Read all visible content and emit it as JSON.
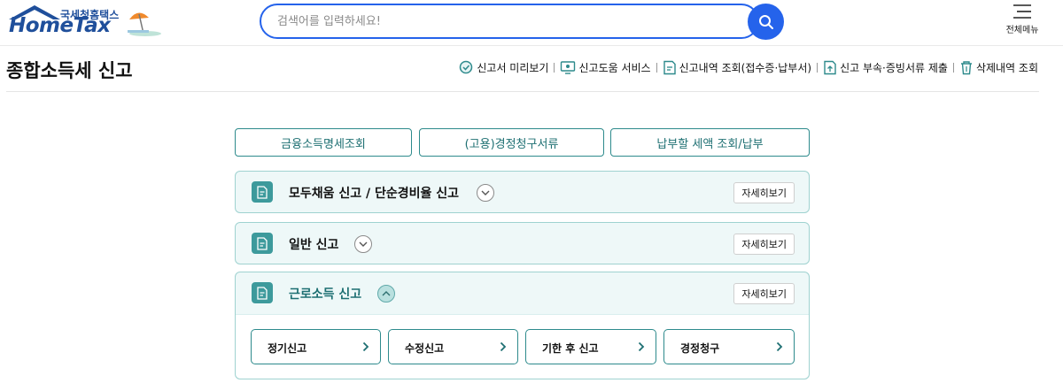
{
  "header": {
    "logo_sub": "국세청홈택스",
    "logo_main": "HomeTax",
    "search_placeholder": "검색어를 입력하세요!",
    "menu_label": "전체메뉴"
  },
  "page": {
    "title": "종합소득세 신고"
  },
  "quick_links": [
    {
      "label": "신고서 미리보기",
      "icon": "magnify-doc-icon"
    },
    {
      "label": "신고도움 서비스",
      "icon": "monitor-help-icon"
    },
    {
      "label": "신고내역 조회(접수증·납부서)",
      "icon": "doc-list-icon"
    },
    {
      "label": "신고 부속·증빙서류 제출",
      "icon": "doc-upload-icon"
    },
    {
      "label": "삭제내역 조회",
      "icon": "trash-icon"
    }
  ],
  "top_buttons": [
    {
      "label": "금융소득명세조회"
    },
    {
      "label": "(고용)경정청구서류"
    },
    {
      "label": "납부할 세액 조회/납부"
    }
  ],
  "cards": [
    {
      "title": "모두채움 신고 / 단순경비율 신고",
      "detail_label": "자세히보기",
      "state": "collapsed"
    },
    {
      "title": "일반 신고",
      "detail_label": "자세히보기",
      "state": "collapsed"
    },
    {
      "title": "근로소득 신고",
      "detail_label": "자세히보기",
      "state": "expanded",
      "sub_buttons": [
        {
          "label": "정기신고"
        },
        {
          "label": "수정신고"
        },
        {
          "label": "기한 후 신고"
        },
        {
          "label": "경정청구"
        }
      ]
    }
  ],
  "colors": {
    "brand_blue": "#2563eb",
    "teal_border": "#2d8a8c",
    "teal_text": "#1d6f72",
    "card_bg": "#eef8f8"
  }
}
